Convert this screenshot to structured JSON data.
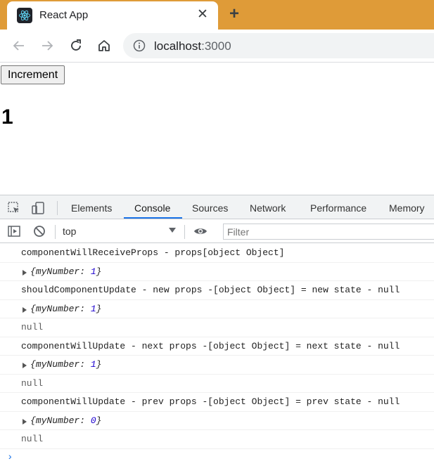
{
  "browser": {
    "tab_title": "React App",
    "close_glyph": "✕",
    "newtab_glyph": "+",
    "url_host": "localhost",
    "url_port": ":3000"
  },
  "page": {
    "button_label": "Increment",
    "counter_value": "1"
  },
  "devtools": {
    "tabs": [
      "Elements",
      "Console",
      "Sources",
      "Network",
      "Performance",
      "Memory"
    ],
    "active_tab": "Console",
    "context": "top",
    "filter_placeholder": "Filter",
    "messages": [
      {
        "kind": "log",
        "text": "componentWillReceiveProps - props[object Object]"
      },
      {
        "kind": "obj",
        "key": "myNumber",
        "value": "1"
      },
      {
        "kind": "log",
        "text": "shouldComponentUpdate - new props -[object Object] = new state - null"
      },
      {
        "kind": "obj",
        "key": "myNumber",
        "value": "1"
      },
      {
        "kind": "null",
        "text": "null"
      },
      {
        "kind": "log",
        "text": "componentWillUpdate - next props -[object Object] = next state - null"
      },
      {
        "kind": "obj",
        "key": "myNumber",
        "value": "1"
      },
      {
        "kind": "null",
        "text": "null"
      },
      {
        "kind": "log",
        "text": "componentWillUpdate - prev props -[object Object] = prev state - null"
      },
      {
        "kind": "obj",
        "key": "myNumber",
        "value": "0"
      },
      {
        "kind": "null",
        "text": "null"
      }
    ],
    "prompt_glyph": "›"
  },
  "colors": {
    "tabstrip": "#df9b38",
    "accent": "#1a73e8"
  }
}
